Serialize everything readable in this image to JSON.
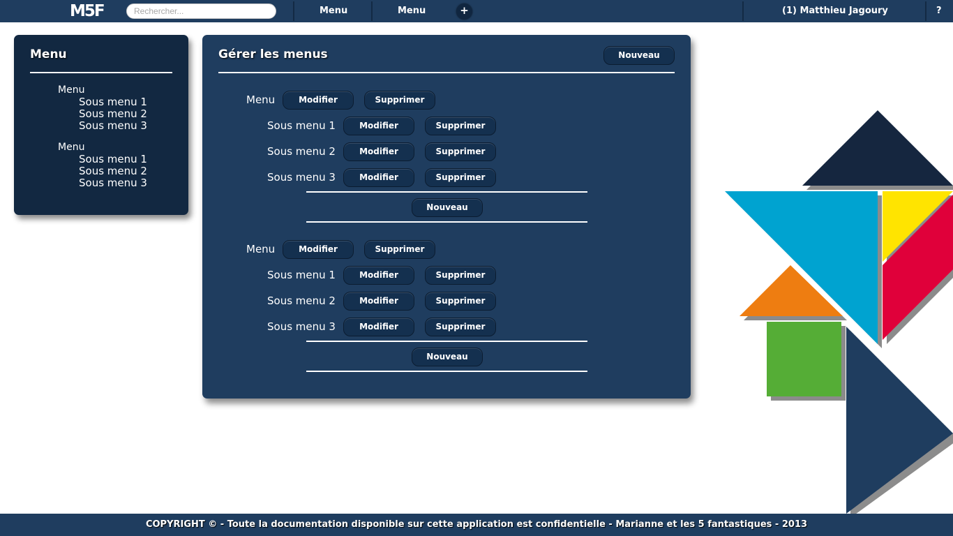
{
  "topbar": {
    "logo": "M5F",
    "search_placeholder": "Rechercher...",
    "nav": [
      "Menu",
      "Menu"
    ],
    "add_label": "+",
    "user": "(1) Matthieu Jagoury",
    "help": "?"
  },
  "sidebar": {
    "title": "Menu",
    "menus": [
      {
        "label": "Menu",
        "subs": [
          "Sous menu 1",
          "Sous menu 2",
          "Sous menu 3"
        ]
      },
      {
        "label": "Menu",
        "subs": [
          "Sous menu 1",
          "Sous menu 2",
          "Sous menu 3"
        ]
      }
    ]
  },
  "main": {
    "title": "Gérer les menus",
    "new_label": "Nouveau",
    "modify_label": "Modifier",
    "delete_label": "Supprimer",
    "groups": [
      {
        "label": "Menu",
        "subs": [
          "Sous menu 1",
          "Sous menu 2",
          "Sous menu 3"
        ]
      },
      {
        "label": "Menu",
        "subs": [
          "Sous menu 1",
          "Sous menu 2",
          "Sous menu 3"
        ]
      }
    ]
  },
  "footer": {
    "text": "COPYRIGHT © - Toute la documentation disponible sur cette application est confidentielle - Marianne et les 5 fantastiques - 2013"
  },
  "colors": {
    "primary": "#1f3d5f",
    "dark": "#122841",
    "tangram_navy": "#15263f",
    "tangram_cyan": "#00a3d0",
    "tangram_yellow": "#ffe400",
    "tangram_red": "#e0003a",
    "tangram_orange": "#ee7d11",
    "tangram_green": "#55ad36",
    "tangram_blue": "#1f3d5f"
  }
}
